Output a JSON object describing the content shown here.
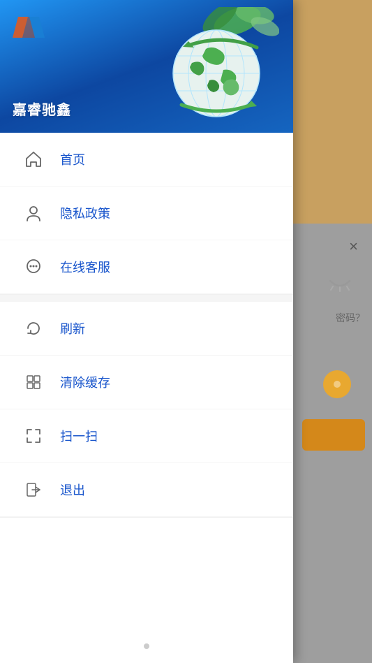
{
  "app": {
    "brand_name": "嘉睿驰鑫",
    "logo_colors": [
      "#e05a20",
      "#1a7fd4"
    ]
  },
  "menu": {
    "section1": [
      {
        "id": "home",
        "label": "首页",
        "icon": "home"
      },
      {
        "id": "privacy",
        "label": "隐私政策",
        "icon": "person"
      },
      {
        "id": "service",
        "label": "在线客服",
        "icon": "chat"
      }
    ],
    "section2": [
      {
        "id": "refresh",
        "label": "刷新",
        "icon": "refresh"
      },
      {
        "id": "clear-cache",
        "label": "清除缓存",
        "icon": "cache"
      },
      {
        "id": "scan",
        "label": "扫一扫",
        "icon": "scan"
      },
      {
        "id": "logout",
        "label": "退出",
        "icon": "logout"
      }
    ]
  },
  "right_panel": {
    "close_icon": "×",
    "eye_icon": "—",
    "pwd_text": "密码？",
    "dot": "•"
  }
}
